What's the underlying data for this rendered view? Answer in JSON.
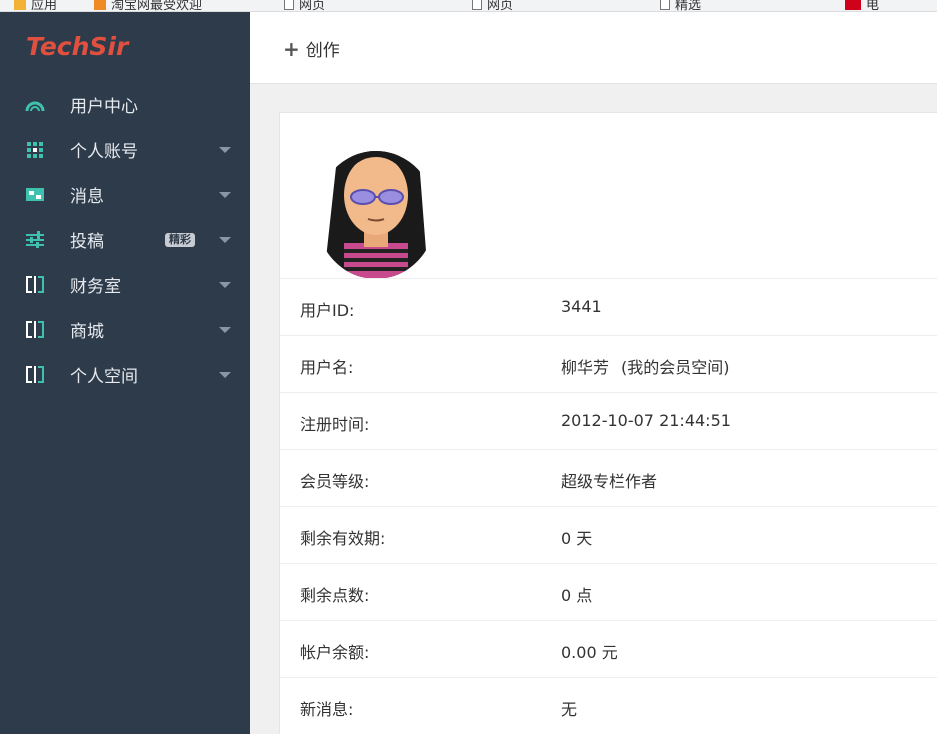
{
  "browser": {
    "bookmarks": [
      {
        "label": "应用",
        "icon": "apps-icon"
      },
      {
        "label": "淘宝网最受欢迎",
        "icon": "cart-icon"
      },
      {
        "label": "网页",
        "icon": "page-icon"
      },
      {
        "label": "网页",
        "icon": "page-icon"
      },
      {
        "label": "精选",
        "icon": "page-icon"
      },
      {
        "label": "电",
        "icon": "red-icon"
      }
    ]
  },
  "sidebar": {
    "logo": "TechSir",
    "items": [
      {
        "label": "用户中心",
        "icon": "dashboard-icon",
        "has_caret": false
      },
      {
        "label": "个人账号",
        "icon": "grid-icon",
        "has_caret": true
      },
      {
        "label": "消息",
        "icon": "message-icon",
        "has_caret": true
      },
      {
        "label": "投稿",
        "icon": "sliders-icon",
        "has_caret": true,
        "badge": "精彩"
      },
      {
        "label": "财务室",
        "icon": "columns-icon",
        "has_caret": true
      },
      {
        "label": "商城",
        "icon": "columns-icon",
        "has_caret": true
      },
      {
        "label": "个人空间",
        "icon": "columns-icon",
        "has_caret": true
      }
    ]
  },
  "header": {
    "create_label": "创作"
  },
  "profile": {
    "rows": [
      {
        "label": "用户ID:",
        "value": "3441"
      },
      {
        "label": "用户名:",
        "value": "柳华芳",
        "sub": "(我的会员空间)"
      },
      {
        "label": "注册时间:",
        "value": "2012-10-07 21:44:51"
      },
      {
        "label": "会员等级:",
        "value": "超级专栏作者"
      },
      {
        "label": "剩余有效期:",
        "value": "0 天"
      },
      {
        "label": "剩余点数:",
        "value": "0 点"
      },
      {
        "label": "帐户余额:",
        "value": "0.00 元"
      },
      {
        "label": "新消息:",
        "value": "无"
      }
    ]
  },
  "colors": {
    "sidebar_bg": "#2e3b4b",
    "logo": "#e0503f",
    "icon_teal": "#3fc1b0",
    "content_bg": "#f0f0f0"
  }
}
